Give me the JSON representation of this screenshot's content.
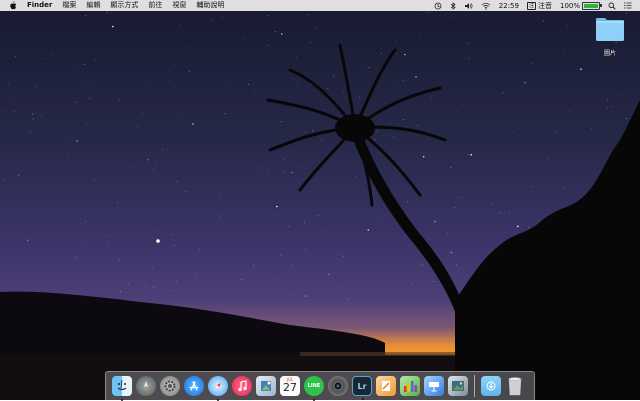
{
  "menubar": {
    "app_name": "Finder",
    "menus": [
      "檔案",
      "編輯",
      "顯示方式",
      "前往",
      "視窗",
      "輔助說明"
    ],
    "clock": "22:59",
    "input_method_chip": "注",
    "input_method_label": "注音",
    "battery_percent_label": "100%",
    "battery_level": 1.0,
    "icons": [
      "apple-icon",
      "time-machine-icon",
      "bluetooth-icon",
      "volume-icon",
      "wifi-icon",
      "battery-icon",
      "search-icon",
      "notification-center-icon"
    ]
  },
  "desktop": {
    "folder_label": "圖片",
    "folder_icon": "folder-icon"
  },
  "dock": {
    "apps": [
      {
        "name": "finder-icon",
        "running": true
      },
      {
        "name": "launchpad-icon",
        "running": false
      },
      {
        "name": "system-preferences-icon",
        "running": false
      },
      {
        "name": "app-store-icon",
        "running": false
      },
      {
        "name": "safari-icon",
        "running": true
      },
      {
        "name": "itunes-icon",
        "running": false
      },
      {
        "name": "preview-icon",
        "running": false
      },
      {
        "name": "calendar-icon",
        "running": false,
        "month": "JUL",
        "day": "27"
      },
      {
        "name": "line-icon",
        "running": true,
        "text": "LINE"
      },
      {
        "name": "camera-icon",
        "running": false
      },
      {
        "name": "lightroom-icon",
        "running": true,
        "text": "Lr"
      },
      {
        "name": "pages-icon",
        "running": false
      },
      {
        "name": "numbers-icon",
        "running": false
      },
      {
        "name": "keynote-icon",
        "running": false
      },
      {
        "name": "photos-icon",
        "running": false
      },
      {
        "name": "downloads-folder-icon",
        "running": false
      },
      {
        "name": "trash-icon",
        "running": false
      }
    ]
  },
  "colors": {
    "menubar_bg": "#ececee",
    "sky_top": "#1b1e35",
    "sky_mid": "#3b3468",
    "horizon_orange": "#f29a2e",
    "battery_green": "#2fb33a"
  }
}
